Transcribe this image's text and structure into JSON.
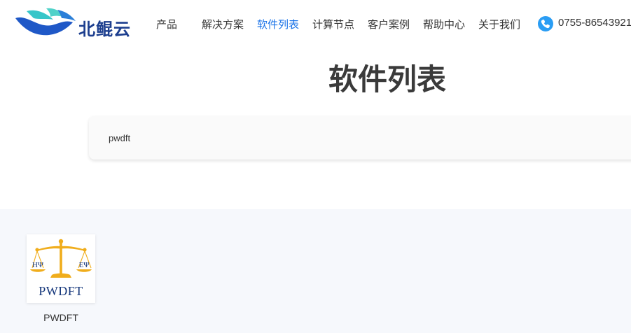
{
  "header": {
    "logo_text": "北鲲云",
    "nav": [
      {
        "label": "产品"
      },
      {
        "label": "解决方案"
      },
      {
        "label": "软件列表"
      },
      {
        "label": "计算节点"
      },
      {
        "label": "客户案例"
      },
      {
        "label": "帮助中心"
      },
      {
        "label": "关于我们"
      }
    ],
    "active_nav": "软件列表",
    "phone": "0755-86543921"
  },
  "main": {
    "title": "软件列表",
    "filter_tags": [
      "pwdft"
    ]
  },
  "software_list": [
    {
      "name": "PWDFT",
      "logo": {
        "text": "PWDFT",
        "left_symbol": "HΨ",
        "right_symbol": "EΨ",
        "icon": "balance-scale-icon"
      }
    }
  ],
  "colors": {
    "accent": "#1a73e8",
    "brand": "#1d3f8f",
    "title": "#3a3a3a",
    "section_bg": "#f6f8fc",
    "scale_gold": "#f0ad1c"
  }
}
